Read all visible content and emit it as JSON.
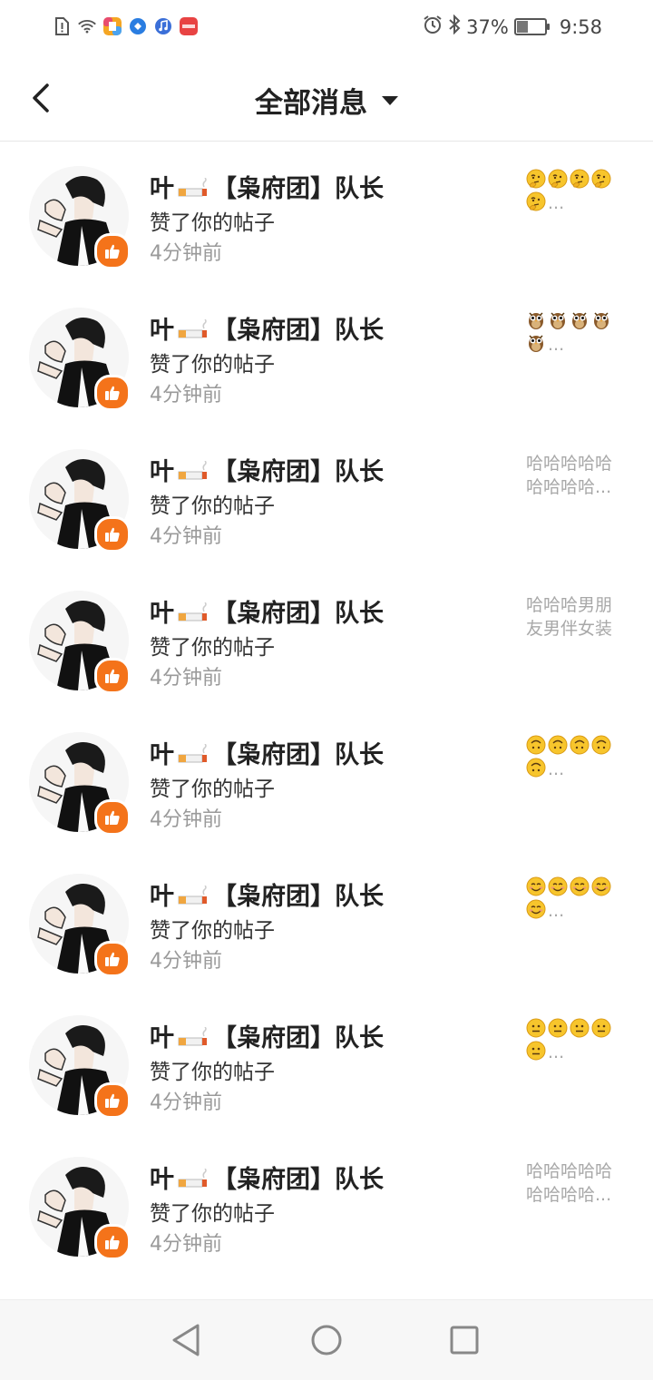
{
  "status_bar": {
    "battery": "37%",
    "battery_level": 0.37,
    "time": "9:58",
    "left_icons": [
      "sim-alert-icon",
      "wifi-icon",
      "app-icon-1",
      "app-icon-2",
      "app-icon-3",
      "app-icon-4"
    ],
    "right_icons": [
      "alarm-icon",
      "bluetooth-icon",
      "battery-icon"
    ]
  },
  "header": {
    "title": "全部消息",
    "back_icon": "back-chevron-icon",
    "dropdown_icon": "caret-down-icon"
  },
  "messages": [
    {
      "name_prefix": "叶",
      "name_suffix": "【枭府团】队长",
      "action": "赞了你的帖子",
      "time": "4分钟前",
      "preview_type": "emoji",
      "emoji": "thinking",
      "emoji_count": 5,
      "preview_text": ""
    },
    {
      "name_prefix": "叶",
      "name_suffix": "【枭府团】队长",
      "action": "赞了你的帖子",
      "time": "4分钟前",
      "preview_type": "emoji",
      "emoji": "owl",
      "emoji_count": 5,
      "preview_text": ""
    },
    {
      "name_prefix": "叶",
      "name_suffix": "【枭府团】队长",
      "action": "赞了你的帖子",
      "time": "4分钟前",
      "preview_type": "text",
      "preview_text": "哈哈哈哈哈哈哈哈哈..."
    },
    {
      "name_prefix": "叶",
      "name_suffix": "【枭府团】队长",
      "action": "赞了你的帖子",
      "time": "4分钟前",
      "preview_type": "text",
      "preview_text": "哈哈哈男朋友男伴女装"
    },
    {
      "name_prefix": "叶",
      "name_suffix": "【枭府团】队长",
      "action": "赞了你的帖子",
      "time": "4分钟前",
      "preview_type": "emoji",
      "emoji": "upside-down",
      "emoji_count": 5,
      "preview_text": ""
    },
    {
      "name_prefix": "叶",
      "name_suffix": "【枭府团】队长",
      "action": "赞了你的帖子",
      "time": "4分钟前",
      "preview_type": "emoji",
      "emoji": "smiling",
      "emoji_count": 5,
      "preview_text": ""
    },
    {
      "name_prefix": "叶",
      "name_suffix": "【枭府团】队长",
      "action": "赞了你的帖子",
      "time": "4分钟前",
      "preview_type": "emoji",
      "emoji": "neutral",
      "emoji_count": 5,
      "preview_text": ""
    },
    {
      "name_prefix": "叶",
      "name_suffix": "【枭府团】队长",
      "action": "赞了你的帖子",
      "time": "4分钟前",
      "preview_type": "text",
      "preview_text": "哈哈哈哈哈哈哈哈哈..."
    }
  ],
  "colors": {
    "badge": "#f4731a",
    "preview_gray": "#a8a8a8",
    "time_gray": "#9a9a9a",
    "title": "#222222"
  },
  "nav_bar": {
    "buttons": [
      "back-triangle-icon",
      "home-circle-icon",
      "recents-square-icon"
    ]
  }
}
